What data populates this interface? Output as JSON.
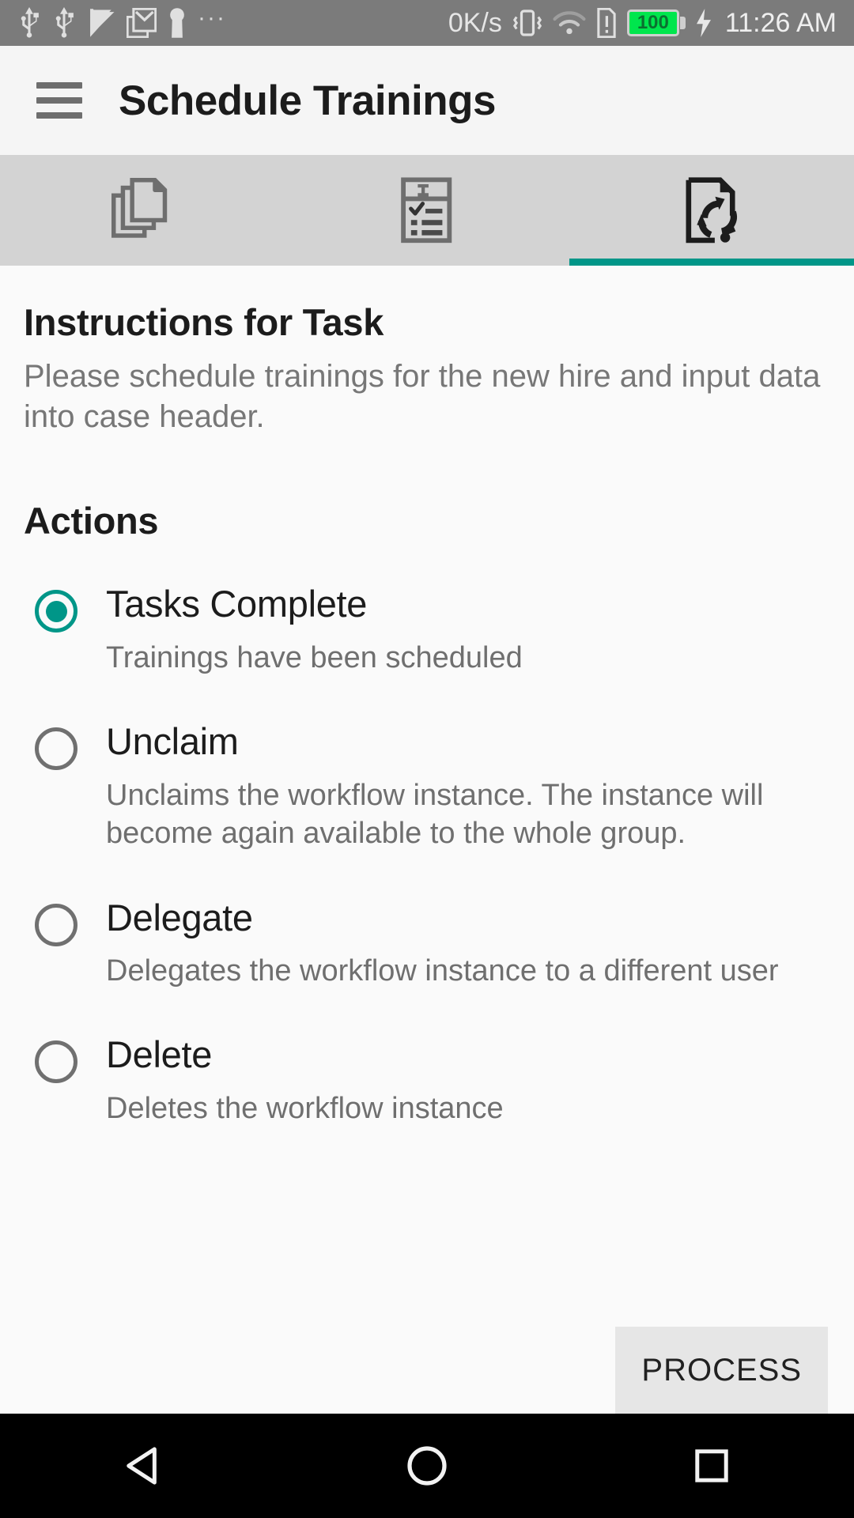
{
  "statusbar": {
    "left_icons": [
      "usb-icon",
      "usb-icon",
      "flag-check-icon",
      "gmail-icon",
      "keyhole-icon",
      "overflow-dots-icon"
    ],
    "overflow": "···",
    "network_speed": "0K/s",
    "right_icons": [
      "vibrate-icon",
      "wifi-icon",
      "sim-alert-icon",
      "battery-icon",
      "charging-bolt-icon"
    ],
    "battery_level": "100",
    "battery_color": "#00e64d",
    "time": "11:26 AM"
  },
  "appbar": {
    "menu_icon": "hamburger-icon",
    "title": "Schedule Trainings"
  },
  "tabs": [
    {
      "name": "documents",
      "icon": "copy-documents-icon",
      "active": false
    },
    {
      "name": "form",
      "icon": "form-checklist-icon",
      "active": false
    },
    {
      "name": "process",
      "icon": "document-process-arrows-icon",
      "active": true
    }
  ],
  "tab_accent_color": "#009688",
  "instructions": {
    "heading": "Instructions for Task",
    "body": "Please schedule trainings for the new hire and input data into case header."
  },
  "actions": {
    "heading": "Actions",
    "selected_index": 0,
    "selected_color": "#009688",
    "options": [
      {
        "label": "Tasks Complete",
        "description": "Trainings have been scheduled",
        "selected": true
      },
      {
        "label": "Unclaim",
        "description": "Unclaims the workflow instance. The instance will become again available to the whole group.",
        "selected": false
      },
      {
        "label": "Delegate",
        "description": "Delegates the workflow instance to a different user",
        "selected": false
      },
      {
        "label": "Delete",
        "description": "Deletes the workflow instance",
        "selected": false
      }
    ]
  },
  "process_button": {
    "label": "PROCESS"
  },
  "navbar": {
    "back": "back-triangle-icon",
    "home": "home-circle-icon",
    "recents": "recents-square-icon"
  }
}
